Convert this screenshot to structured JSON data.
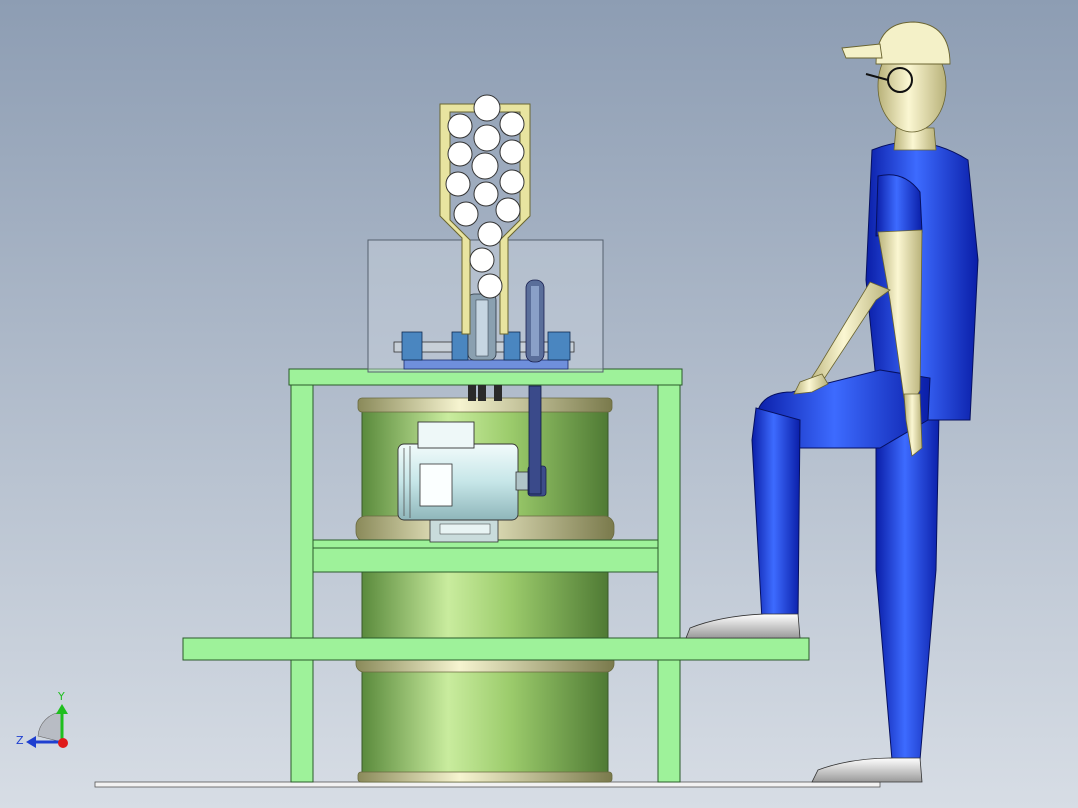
{
  "viewport": {
    "background_top": "#8d9db3",
    "background_bottom": "#d7dde5"
  },
  "triad": {
    "y_label": "Y",
    "z_label": "Z",
    "y_color": "#1fbf1f",
    "z_color": "#1f3fd0",
    "x_color": "#e01a1a"
  },
  "colors": {
    "frame": "#9ef29a",
    "frame_edge": "#2a5a2a",
    "drum": "#9ccc6c",
    "drum_rim": "#e8e6b0",
    "motor": "#d8f0f0",
    "hopper": "#d8d480",
    "shaft": "#6f8fa0",
    "bearing": "#5a8ec0",
    "belt": "#3a4a8a",
    "guard": "#c8d0dc",
    "suit": "#1535e0",
    "skin": "#ece6b0",
    "cap": "#f0eec0",
    "shoe": "#e6e6e6"
  }
}
